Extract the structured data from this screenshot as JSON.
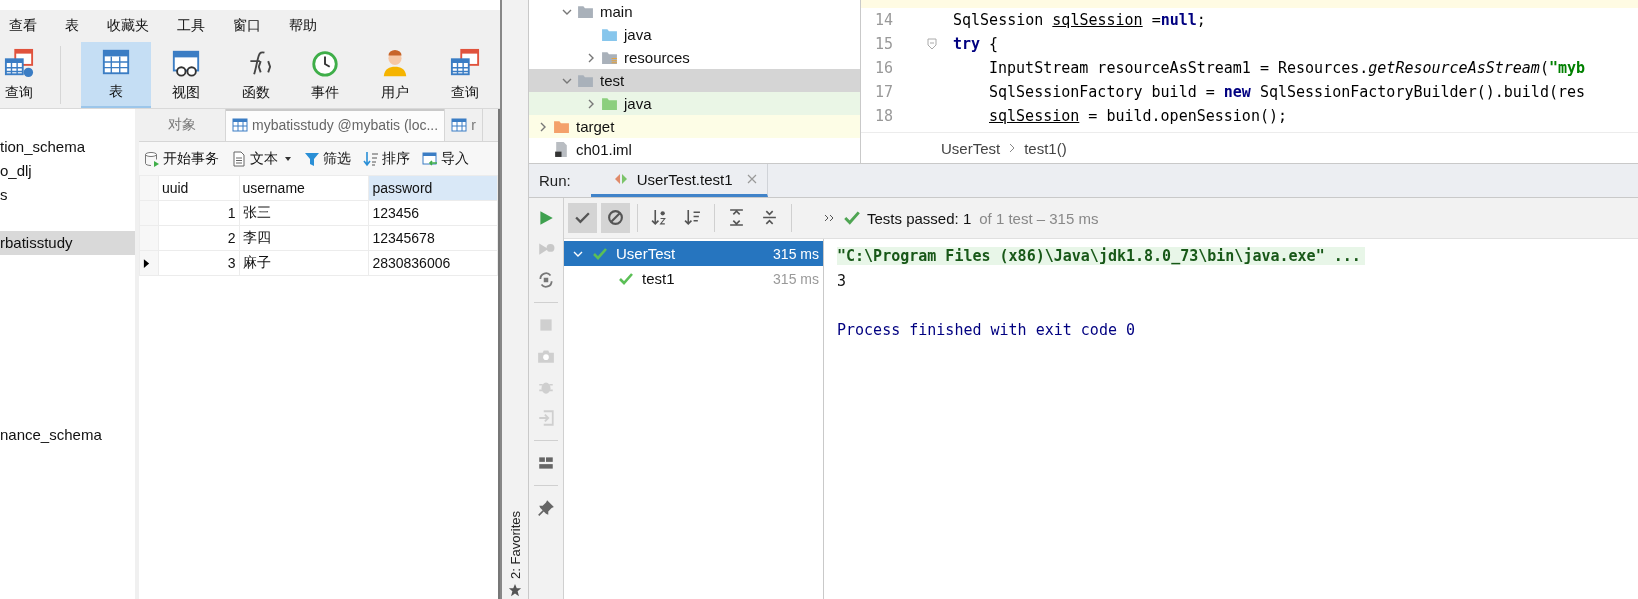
{
  "navicat": {
    "menu": [
      "查看",
      "表",
      "收藏夹",
      "工具",
      "窗口",
      "帮助"
    ],
    "toolbar": [
      {
        "label": "查询",
        "kind": "new-query",
        "selected": false
      },
      {
        "label": "表",
        "kind": "table",
        "selected": true
      },
      {
        "label": "视图",
        "kind": "view",
        "selected": false
      },
      {
        "label": "函数",
        "kind": "function",
        "selected": false
      },
      {
        "label": "事件",
        "kind": "event",
        "selected": false
      },
      {
        "label": "用户",
        "kind": "user",
        "selected": false
      },
      {
        "label": "查询",
        "kind": "query",
        "selected": false
      }
    ],
    "sidebar": {
      "items": [
        {
          "label": "tion_schema",
          "selected": false
        },
        {
          "label": "o_dlj",
          "selected": false
        },
        {
          "label": "s",
          "selected": false
        },
        {
          "label": "rbatisstudy",
          "selected": true
        },
        {
          "label": "nance_schema",
          "selected": false
        }
      ]
    },
    "tabs": [
      {
        "label": "对象",
        "kind": "objects",
        "selected": false
      },
      {
        "label": "mybatisstudy @mybatis (loc...",
        "kind": "table",
        "selected": true
      },
      {
        "label": "r",
        "kind": "table",
        "selected": false
      }
    ],
    "table_toolbar": [
      {
        "label": "开始事务",
        "kind": "transaction"
      },
      {
        "label": "文本",
        "kind": "text"
      },
      {
        "label": "筛选",
        "kind": "filter"
      },
      {
        "label": "排序",
        "kind": "sort"
      },
      {
        "label": "导入",
        "kind": "import"
      }
    ],
    "table": {
      "columns": [
        {
          "label": "uuid",
          "selected": false
        },
        {
          "label": "username",
          "selected": false
        },
        {
          "label": "password",
          "selected": true
        }
      ],
      "rows": [
        {
          "cells": [
            "1",
            "张三",
            "123456"
          ],
          "selected": false
        },
        {
          "cells": [
            "2",
            "李四",
            "12345678"
          ],
          "selected": false
        },
        {
          "cells": [
            "3",
            "麻子",
            "2830836006"
          ],
          "selected": true
        }
      ]
    }
  },
  "ide": {
    "side_strip": {
      "label": "2: Favorites"
    },
    "project_tree": [
      {
        "children": [
          {
            "label": "main",
            "kind": "folder",
            "expanded": true,
            "selected": false,
            "children": [
              {
                "label": "java",
                "kind": "source",
                "selected": false
              },
              {
                "label": "resources",
                "kind": "resources",
                "expanded": false,
                "selected": false
              }
            ]
          },
          {
            "label": "test",
            "kind": "folder",
            "expanded": true,
            "selected": true,
            "children": [
              {
                "label": "java",
                "kind": "test-source",
                "expanded": false,
                "selected": false
              }
            ]
          }
        ]
      },
      {
        "label": "target",
        "kind": "excluded",
        "expanded": false,
        "selected": false
      },
      {
        "label": "ch01.iml",
        "kind": "module-file",
        "selected": false
      }
    ],
    "editor": {
      "lines": [
        {
          "number": "14",
          "tokens": [
            {
              "text": "SqlSession ",
              "kind": "plain"
            },
            {
              "text": "sqlSession",
              "kind": "var"
            },
            {
              "text": " =",
              "kind": "plain"
            },
            {
              "text": "null",
              "kind": "keyword"
            },
            {
              "text": ";",
              "kind": "plain"
            }
          ]
        },
        {
          "number": "15",
          "tokens": [
            {
              "text": "try",
              "kind": "keyword"
            },
            {
              "text": " {",
              "kind": "plain"
            }
          ],
          "children": [
            {
              "number": "16",
              "tokens": [
                {
                  "text": "InputStream resourceAsStream1 = Resources.",
                  "kind": "plain"
                },
                {
                  "text": "getResourceAsStream",
                  "kind": "static"
                },
                {
                  "text": "(",
                  "kind": "plain"
                },
                {
                  "text": "\"myb",
                  "kind": "string"
                }
              ]
            },
            {
              "number": "17",
              "tokens": [
                {
                  "text": "SqlSessionFactory build = ",
                  "kind": "plain"
                },
                {
                  "text": "new",
                  "kind": "keyword"
                },
                {
                  "text": " SqlSessionFactoryBuilder().build(res",
                  "kind": "plain"
                }
              ]
            },
            {
              "number": "18",
              "tokens": [
                {
                  "text": "sqlSession",
                  "kind": "var"
                },
                {
                  "text": " = build.openSession();",
                  "kind": "plain"
                }
              ]
            }
          ]
        }
      ]
    },
    "breadcrumb": [
      "UserTest",
      "test1()"
    ],
    "run": {
      "title": "Run:",
      "tab": {
        "label": "UserTest.test1",
        "selected": true
      },
      "toolbar": [
        {
          "kind": "show-passed",
          "on": true
        },
        {
          "kind": "show-ignored",
          "on": true
        },
        {
          "kind": "sort-alpha",
          "on": false
        },
        {
          "kind": "sort-duration",
          "on": false
        },
        {
          "kind": "expand-all",
          "on": false
        },
        {
          "kind": "collapse-all",
          "on": false
        }
      ],
      "status": {
        "label": "Tests passed: 1",
        "detail": "of 1 test – 315 ms"
      },
      "tests": [
        {
          "label": "UserTest",
          "time": "315 ms",
          "passed": true,
          "selected": true,
          "expanded": true,
          "children": [
            {
              "label": "test1",
              "time": "315 ms",
              "passed": true,
              "selected": false
            }
          ]
        }
      ],
      "console": [
        {
          "text": "\"C:\\Program Files (x86)\\Java\\jdk1.8.0_73\\bin\\java.exe\" ...",
          "kind": "command"
        },
        {
          "text": "3",
          "kind": "output"
        },
        {
          "text": "Process finished with exit code 0",
          "kind": "system"
        }
      ]
    }
  }
}
